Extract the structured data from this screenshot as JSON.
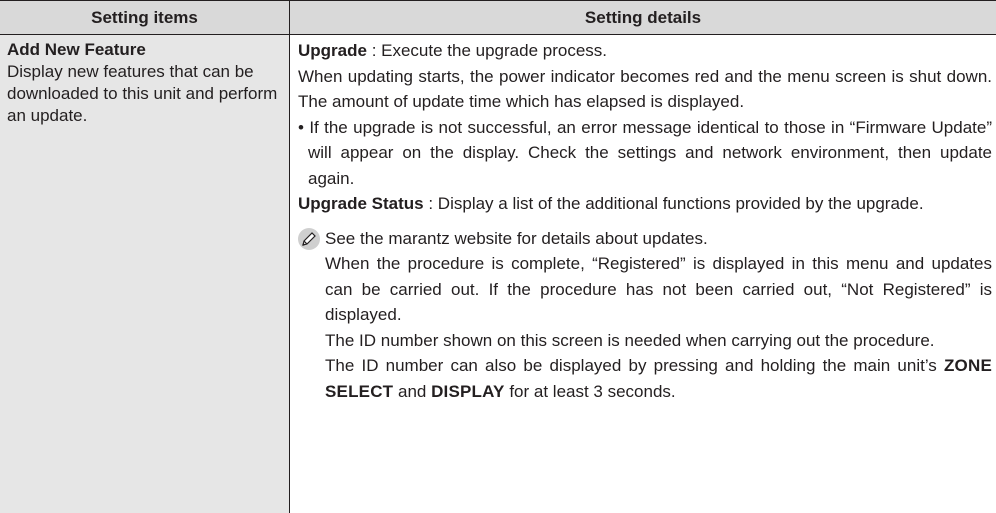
{
  "header": {
    "col1": "Setting items",
    "col2": "Setting details"
  },
  "item": {
    "title": "Add New Feature",
    "description": "Display new features that can be downloaded to this unit and perform an update."
  },
  "details": {
    "upgrade_label": "Upgrade",
    "upgrade_desc": " : Execute the upgrade process.",
    "upgrade_para": "When updating starts, the power indicator becomes red and the menu screen is shut down. The amount of update time which has elapsed is displayed.",
    "bullet": "• If the upgrade is not successful, an error message identical to those in “Firmware Update” will appear on the display. Check the settings and network environment, then update again.",
    "status_label": "Upgrade Status",
    "status_desc": " : Display a list of the additional functions provided by the upgrade.",
    "note_icon": "pencil-icon",
    "note_line1": "See the marantz website for details about updates.",
    "note_line2": "When the procedure is complete, “Registered” is displayed in this menu and updates can be carried out. If the procedure has not been carried out, “Not Registered” is displayed.",
    "note_line3": "The ID number shown on this screen is needed when carrying out the procedure.",
    "note_line4_pre": "The ID number can also be displayed by pressing and holding the main unit’s ",
    "note_line4_key1": "ZONE SELECT",
    "note_line4_mid": " and ",
    "note_line4_key2": "DISPLAY",
    "note_line4_post": " for at least 3 seconds."
  }
}
